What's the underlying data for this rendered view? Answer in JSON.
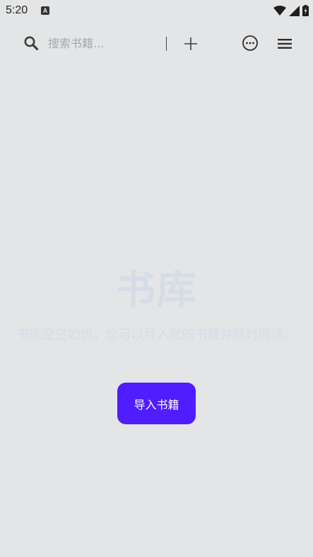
{
  "status_bar": {
    "time": "5:20",
    "notification_icon_letter": "A",
    "icons": [
      "wifi-icon",
      "cell-signal-icon",
      "battery-icon"
    ]
  },
  "toolbar": {
    "search_icon": "search-icon",
    "search_placeholder": "搜索书籍...",
    "add_icon": "plus-icon",
    "more_icon": "more-circle-icon",
    "menu_icon": "menu-icon"
  },
  "empty_state": {
    "title": "书库",
    "message": "书库空空如也，您可以导入您的书籍并随时阅读。",
    "import_button_label": "导入书籍"
  },
  "colors": {
    "background": "#e4e5e6",
    "accent": "#4f1dff",
    "faded_text": "#d6dce6",
    "placeholder": "#a6a8ab"
  }
}
